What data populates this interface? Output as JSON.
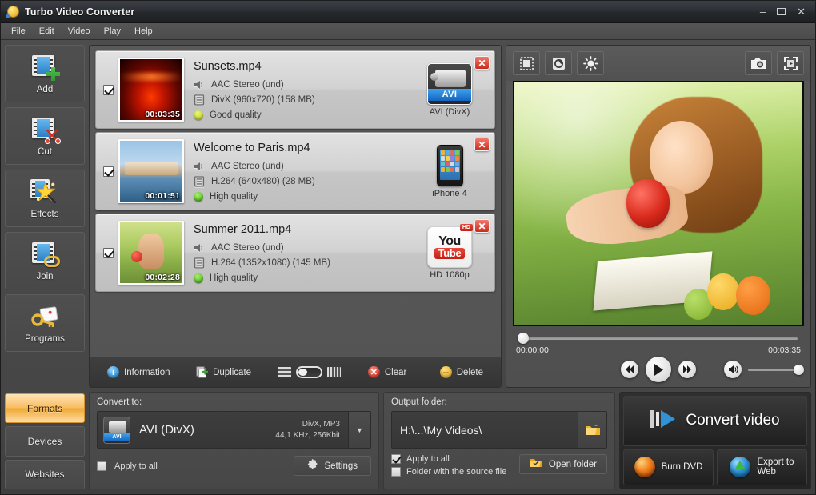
{
  "window": {
    "title": "Turbo Video Converter",
    "minimize": "–",
    "maximize": "❐",
    "close": "✕"
  },
  "menu": {
    "items": [
      "File",
      "Edit",
      "Video",
      "Play",
      "Help"
    ]
  },
  "sidebar": {
    "items": [
      {
        "label": "Add",
        "icon": "film-add-icon"
      },
      {
        "label": "Cut",
        "icon": "film-scissors-icon"
      },
      {
        "label": "Effects",
        "icon": "magic-wand-icon"
      },
      {
        "label": "Join",
        "icon": "film-link-icon"
      },
      {
        "label": "Programs",
        "icon": "key-programs-icon"
      }
    ]
  },
  "filelist": {
    "items": [
      {
        "checked": true,
        "name": "Sunsets.mp4",
        "duration": "00:03:35",
        "audio": "AAC Stereo (und)",
        "video": "DivX (960x720) (158 MB)",
        "quality": "Good quality",
        "quality_color": "#ccdd22",
        "target_label": "AVI (DivX)",
        "target_kind": "avi",
        "target_badge": "AVI",
        "close": "✕"
      },
      {
        "checked": true,
        "name": "Welcome to Paris.mp4",
        "duration": "00:01:51",
        "audio": "AAC Stereo (und)",
        "video": "H.264 (640x480) (28 MB)",
        "quality": "High quality",
        "quality_color": "#5fd320",
        "target_label": "iPhone 4",
        "target_kind": "iphone",
        "target_badge": "",
        "close": "✕"
      },
      {
        "checked": true,
        "name": "Summer 2011.mp4",
        "duration": "00:02:28",
        "audio": "AAC Stereo (und)",
        "video": "H.264 (1352x1080) (145 MB)",
        "quality": "High quality",
        "quality_color": "#5fd320",
        "target_label": "HD 1080p",
        "target_kind": "youtube",
        "target_badge": "HD",
        "youtube_top": "You",
        "youtube_bottom": "Tube",
        "close": "✕"
      }
    ]
  },
  "list_toolbar": {
    "information": "Information",
    "duplicate": "Duplicate",
    "clear": "Clear",
    "delete": "Delete"
  },
  "preview": {
    "toolbar": {
      "crop": "crop-icon",
      "rotate": "rotate-icon",
      "brightness": "brightness-icon",
      "snapshot": "camera-snapshot-icon",
      "fullscreen": "fullscreen-icon"
    },
    "player": {
      "current_time": "00:00:00",
      "total_time": "00:03:35",
      "previous": "⏮",
      "play": "▶",
      "next": "⏭",
      "volume_icon": "speaker-icon",
      "seek_percent": 0,
      "volume_percent": 100
    }
  },
  "footer": {
    "tabs": [
      {
        "label": "Formats",
        "active": true
      },
      {
        "label": "Devices",
        "active": false
      },
      {
        "label": "Websites",
        "active": false
      }
    ],
    "convert": {
      "label": "Convert to:",
      "format_name": "AVI (DivX)",
      "format_badge": "AVI",
      "spec_line1": "DivX, MP3",
      "spec_line2": "44,1 KHz, 256Kbit",
      "arrow": "▼",
      "apply_to_all": "Apply to all",
      "apply_to_all_checked": false,
      "settings": "Settings"
    },
    "output": {
      "label": "Output folder:",
      "path": "H:\\...\\My Videos\\",
      "apply_to_all": "Apply to all",
      "apply_to_all_checked": true,
      "source_folder": "Folder with the source file",
      "source_folder_checked": false,
      "open_folder": "Open folder"
    },
    "actions": {
      "convert_video": "Convert video",
      "burn_dvd": "Burn DVD",
      "export_web_line1": "Export to",
      "export_web_line2": "Web"
    }
  },
  "colors": {
    "accent_orange": "#f0a833",
    "accent_blue": "#1565c0",
    "danger_red": "#c92d1c",
    "good_quality": "#ccdd22",
    "high_quality": "#5fd320"
  }
}
